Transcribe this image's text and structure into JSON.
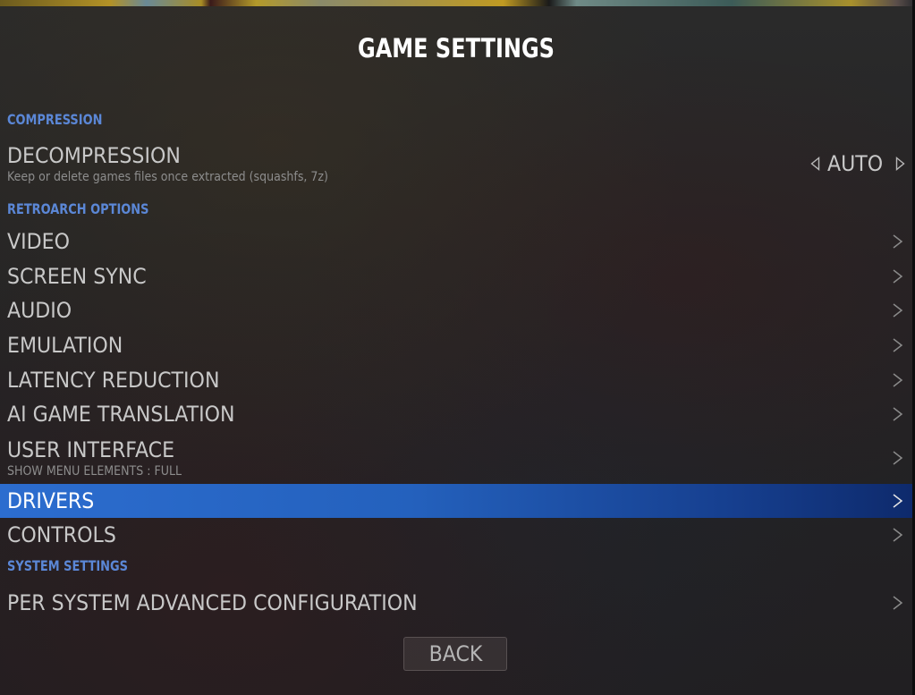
{
  "header": {
    "title": "GAME SETTINGS"
  },
  "colors": {
    "section_header": "#5b87d6",
    "selected_start": "#2c6dcf",
    "selected_end": "#0e2a6c",
    "item_text": "#c8c8c8",
    "subtext": "#8d8d8d"
  },
  "sections": {
    "compression": {
      "title": "COMPRESSION",
      "items": [
        {
          "label": "DECOMPRESSION",
          "description": "Keep or delete games files once extracted (squashfs, 7z)",
          "value": "AUTO",
          "prev_icon": "triangle-left-icon",
          "next_icon": "triangle-right-icon"
        }
      ]
    },
    "retroarch": {
      "title": "RETROARCH OPTIONS",
      "items": [
        {
          "label": "VIDEO",
          "icon": "chevron-right-icon"
        },
        {
          "label": "SCREEN SYNC",
          "icon": "chevron-right-icon"
        },
        {
          "label": "AUDIO",
          "icon": "chevron-right-icon"
        },
        {
          "label": "EMULATION",
          "icon": "chevron-right-icon"
        },
        {
          "label": "LATENCY REDUCTION",
          "icon": "chevron-right-icon"
        },
        {
          "label": "AI GAME TRANSLATION",
          "icon": "chevron-right-icon"
        },
        {
          "label": "USER INTERFACE",
          "description": "SHOW MENU ELEMENTS : FULL",
          "icon": "chevron-right-icon"
        },
        {
          "label": "DRIVERS",
          "icon": "chevron-right-icon",
          "selected": true
        },
        {
          "label": "CONTROLS",
          "icon": "chevron-right-icon"
        }
      ]
    },
    "system": {
      "title": "SYSTEM SETTINGS",
      "items": [
        {
          "label": "PER SYSTEM ADVANCED CONFIGURATION",
          "icon": "chevron-right-icon"
        }
      ]
    }
  },
  "footer": {
    "back_label": "BACK"
  }
}
